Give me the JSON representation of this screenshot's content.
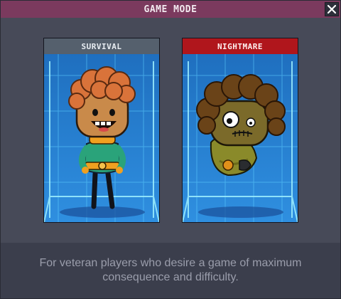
{
  "window": {
    "title": "GAME MODE",
    "close_icon": "close-icon"
  },
  "modes": [
    {
      "label": "SURVIVAL",
      "header_color": "#55606d"
    },
    {
      "label": "NIGHTMARE",
      "header_color": "#b0161c",
      "selected": true
    }
  ],
  "description": "For veteran players who desire a game of maximum consequence and difficulty."
}
